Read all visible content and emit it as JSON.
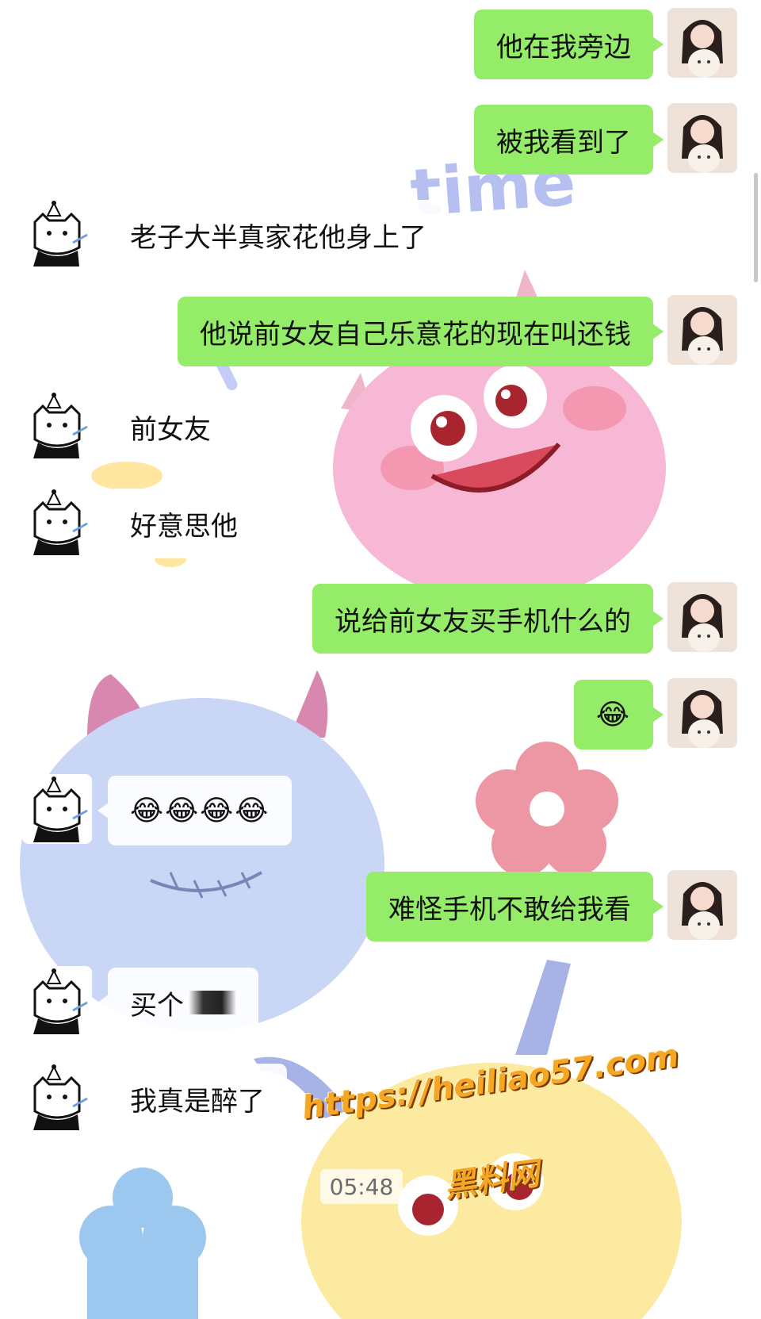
{
  "chat": {
    "messages": [
      {
        "from": "self",
        "text": "他在我旁边"
      },
      {
        "from": "self",
        "text": "被我看到了"
      },
      {
        "from": "other",
        "text": "老子大半真家花他身上了"
      },
      {
        "from": "self",
        "text": "他说前女友自己乐意花的现在叫还钱"
      },
      {
        "from": "other",
        "text": "前女友"
      },
      {
        "from": "other",
        "text": "好意思他"
      },
      {
        "from": "self",
        "text": "说给前女友买手机什么的"
      },
      {
        "from": "self",
        "text": "😂"
      },
      {
        "from": "other",
        "text": "😂😂😂😂"
      },
      {
        "from": "self",
        "text": "难怪手机不敢给我看"
      },
      {
        "from": "other",
        "text": "买个"
      },
      {
        "from": "other",
        "text": "我真是醉了"
      }
    ],
    "timestamp": "05:48"
  },
  "background": {
    "sticker_text": "time"
  },
  "watermark": {
    "url": "https://heiliao57.com",
    "name": "黑料网"
  },
  "icons": {
    "self_avatar": "girl-with-bunny-avatar",
    "other_avatar": "cat-with-party-hat-avatar"
  }
}
